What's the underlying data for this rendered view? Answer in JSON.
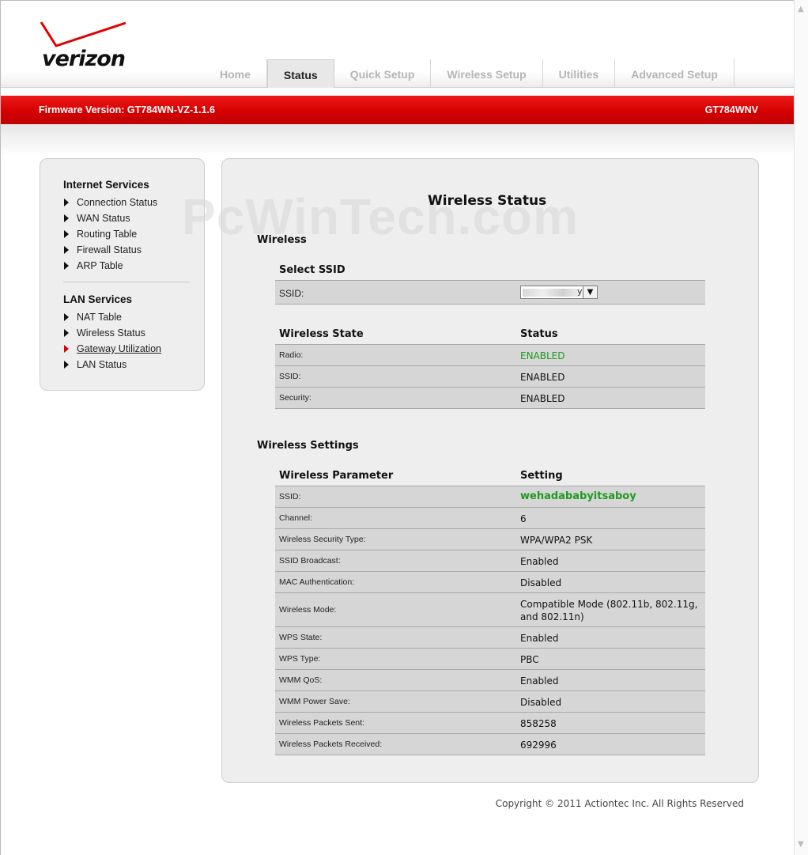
{
  "brand": {
    "logo_text": "verizon",
    "accent": "#d50000"
  },
  "nav": {
    "tabs": [
      {
        "label": "Home",
        "active": false
      },
      {
        "label": "Status",
        "active": true
      },
      {
        "label": "Quick Setup",
        "active": false
      },
      {
        "label": "Wireless Setup",
        "active": false
      },
      {
        "label": "Utilities",
        "active": false
      },
      {
        "label": "Advanced Setup",
        "active": false
      }
    ]
  },
  "banner": {
    "firmware": "Firmware Version: GT784WN-VZ-1.1.6",
    "model": "GT784WNV"
  },
  "watermark": "PcWinTech.com",
  "sidebar": {
    "internet_heading": "Internet Services",
    "internet_items": [
      "Connection Status",
      "WAN Status",
      "Routing Table",
      "Firewall Status",
      "ARP Table"
    ],
    "lan_heading": "LAN Services",
    "lan_items": [
      "NAT Table",
      "Wireless Status",
      "Gateway Utilization",
      "LAN Status"
    ],
    "current_item": "Gateway Utilization"
  },
  "main": {
    "title": "Wireless Status",
    "wireless": {
      "heading": "Wireless",
      "select_heading": "Select SSID",
      "ssid_label": "SSID:",
      "ssid_fragment": "yi",
      "state_header": "Wireless State",
      "status_header": "Status",
      "states": [
        {
          "key": "Radio:",
          "value": "ENABLED"
        },
        {
          "key": "SSID:",
          "value": "ENABLED"
        },
        {
          "key": "Security:",
          "value": "ENABLED"
        }
      ]
    },
    "settings": {
      "heading": "Wireless Settings",
      "param_header": "Wireless Parameter",
      "setting_header": "Setting",
      "rows": [
        {
          "key": "SSID:",
          "value": "wehadababyitsaboy"
        },
        {
          "key": "Channel:",
          "value": "6"
        },
        {
          "key": "Wireless Security Type:",
          "value": "WPA/WPA2 PSK"
        },
        {
          "key": "SSID Broadcast:",
          "value": "Enabled"
        },
        {
          "key": "MAC Authentication:",
          "value": "Disabled"
        },
        {
          "key": "Wireless Mode:",
          "value_line1": "Compatible Mode (802.11b, 802.11g,",
          "value_line2": "and 802.11n)"
        },
        {
          "key": "WPS State:",
          "value": "Enabled"
        },
        {
          "key": "WPS Type:",
          "value": "PBC"
        },
        {
          "key": "WMM QoS:",
          "value": "Enabled"
        },
        {
          "key": "WMM Power Save:",
          "value": "Disabled"
        },
        {
          "key": "Wireless Packets Sent:",
          "value": "858258"
        },
        {
          "key": "Wireless Packets Received:",
          "value": "692996"
        }
      ]
    }
  },
  "footer": {
    "copyright": "Copyright © 2011 Actiontec Inc. All Rights Reserved"
  }
}
